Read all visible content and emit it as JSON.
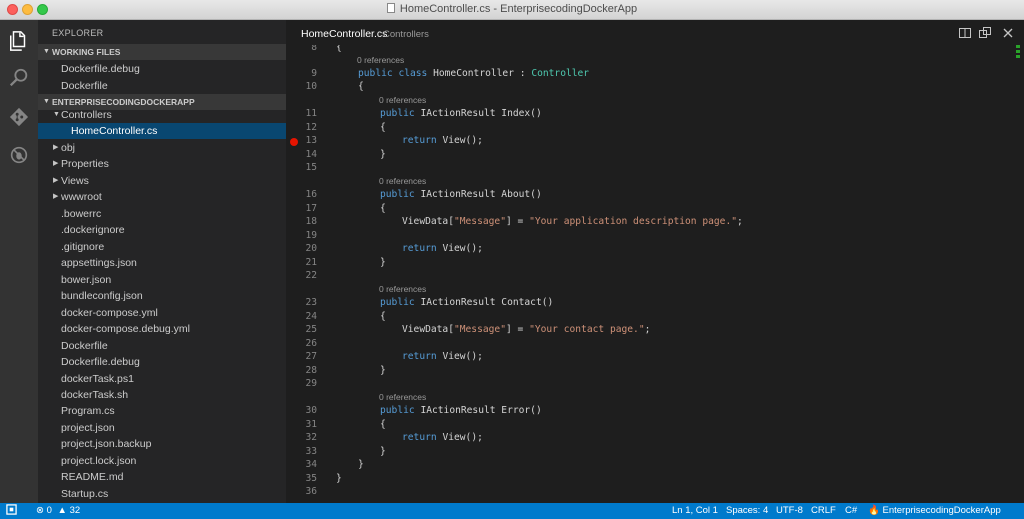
{
  "window": {
    "title": "HomeController.cs - EnterprisecodingDockerApp"
  },
  "activity_bar": {
    "icons": [
      "explorer-icon",
      "search-icon",
      "git-icon",
      "debug-icon"
    ]
  },
  "sidebar": {
    "title": "EXPLORER",
    "working_files": {
      "label": "WORKING FILES",
      "items": [
        "Dockerfile.debug",
        "Dockerfile"
      ]
    },
    "project": {
      "label": "ENTERPRISECODINGDOCKERAPP",
      "controllers_folder": "Controllers",
      "selected_file": "HomeController.cs",
      "folders": [
        "obj",
        "Properties",
        "Views",
        "wwwroot"
      ],
      "files": [
        ".bowerrc",
        ".dockerignore",
        ".gitignore",
        "appsettings.json",
        "bower.json",
        "bundleconfig.json",
        "docker-compose.yml",
        "docker-compose.debug.yml",
        "Dockerfile",
        "Dockerfile.debug",
        "dockerTask.ps1",
        "dockerTask.sh",
        "Program.cs",
        "project.json",
        "project.json.backup",
        "project.lock.json",
        "README.md",
        "Startup.cs"
      ]
    }
  },
  "editor": {
    "tab": {
      "file": "HomeController.cs",
      "description": "Controllers"
    },
    "codelens": "0 references",
    "lines": [
      {
        "n": "8",
        "code": "{"
      },
      {
        "n": "9",
        "kw1": "public",
        "kw2": "class",
        "name": "HomeController",
        "sep": " : ",
        "base": "Controller"
      },
      {
        "n": "10",
        "code": "{"
      },
      {
        "n": "11",
        "sig": "IActionResult Index()"
      },
      {
        "n": "12",
        "code": "{"
      },
      {
        "n": "13",
        "ret": "View();"
      },
      {
        "n": "14",
        "code": "}"
      },
      {
        "n": "15",
        "code": ""
      },
      {
        "n": "16",
        "sig": "IActionResult About()"
      },
      {
        "n": "17",
        "code": "{"
      },
      {
        "n": "18",
        "vd": "ViewData[",
        "key": "\"Message\"",
        "mid": "] = ",
        "val": "\"Your application description page.\"",
        "end": ";"
      },
      {
        "n": "19",
        "code": ""
      },
      {
        "n": "20",
        "ret": "View();"
      },
      {
        "n": "21",
        "code": "}"
      },
      {
        "n": "22",
        "code": ""
      },
      {
        "n": "23",
        "sig": "IActionResult Contact()"
      },
      {
        "n": "24",
        "code": "{"
      },
      {
        "n": "25",
        "vd": "ViewData[",
        "key": "\"Message\"",
        "mid": "] = ",
        "val": "\"Your contact page.\"",
        "end": ";"
      },
      {
        "n": "26",
        "code": ""
      },
      {
        "n": "27",
        "ret": "View();"
      },
      {
        "n": "28",
        "code": "}"
      },
      {
        "n": "29",
        "code": ""
      },
      {
        "n": "30",
        "sig": "IActionResult Error()"
      },
      {
        "n": "31",
        "code": "{"
      },
      {
        "n": "32",
        "ret": "View();"
      },
      {
        "n": "33",
        "code": "}"
      },
      {
        "n": "34",
        "code": "}"
      },
      {
        "n": "35",
        "code": "}"
      },
      {
        "n": "36",
        "code": ""
      }
    ],
    "keywords": {
      "public": "public",
      "return": "return"
    }
  },
  "status_bar": {
    "errors": "0",
    "warnings": "32",
    "position": "Ln 1, Col 1",
    "indent": "Spaces: 4",
    "encoding": "UTF-8",
    "eol": "CRLF",
    "language": "C#",
    "project": "EnterprisecodingDockerApp"
  },
  "colors": {
    "status_bar": "#007acc",
    "selection": "#094771",
    "keyword": "#569cd6",
    "type": "#4ec9b0",
    "string": "#ce9178",
    "breakpoint": "#e51400"
  }
}
